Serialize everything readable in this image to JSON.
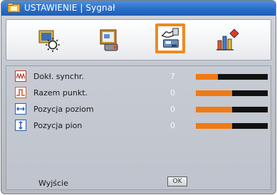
{
  "window": {
    "title": "USTAWIENIE | Sygnał",
    "title_icon": "settings-folder-icon"
  },
  "tabs": [
    {
      "name": "image-settings",
      "icon": "brightness-icon",
      "active": false
    },
    {
      "name": "display-settings",
      "icon": "display-icon",
      "active": false
    },
    {
      "name": "setup-settings",
      "icon": "setup-icon",
      "active": true
    },
    {
      "name": "options-settings",
      "icon": "options-icon",
      "active": false
    }
  ],
  "rows": [
    {
      "label": "Dokł. synchr.",
      "value": "7",
      "icon": "frequency-wave-icon",
      "fill_fraction": 0.31
    },
    {
      "label": "Razem punkt.",
      "value": "0",
      "icon": "phase-step-icon",
      "fill_fraction": 0.5
    },
    {
      "label": "Pozycja poziom",
      "value": "0",
      "icon": "horizontal-arrows-icon",
      "fill_fraction": 0.5
    },
    {
      "label": "Pozycja pion",
      "value": "0",
      "icon": "vertical-arrows-icon",
      "fill_fraction": 0.5
    }
  ],
  "exit": {
    "label": "Wyjście",
    "button_label": "OK"
  },
  "colors": {
    "title_bar": "#2a6ec9",
    "active_tab_border": "#f08a1e",
    "slider_fill": "#f07a14",
    "slider_track": "#111111"
  }
}
